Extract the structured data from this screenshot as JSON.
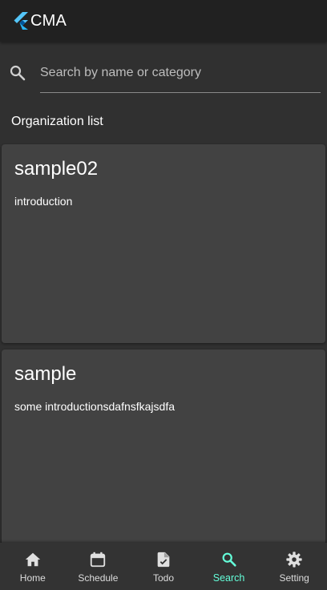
{
  "app": {
    "title": "CMA"
  },
  "search": {
    "placeholder": "Search by name or category",
    "value": ""
  },
  "section": {
    "title": "Organization list"
  },
  "organizations": [
    {
      "name": "sample02",
      "description": "introduction"
    },
    {
      "name": "sample",
      "description": "some introductionsdafnsfkajsdfa"
    }
  ],
  "bottom_nav": {
    "items": [
      {
        "label": "Home",
        "icon": "home-icon"
      },
      {
        "label": "Schedule",
        "icon": "calendar-icon"
      },
      {
        "label": "Todo",
        "icon": "todo-icon"
      },
      {
        "label": "Search",
        "icon": "search-icon"
      },
      {
        "label": "Setting",
        "icon": "gear-icon"
      }
    ],
    "active": "Search"
  },
  "colors": {
    "appbar": "#212121",
    "background": "#303030",
    "card": "#424242",
    "accent": "#64ffda",
    "logo_light": "#54c5f8",
    "logo_dark": "#01579b"
  }
}
